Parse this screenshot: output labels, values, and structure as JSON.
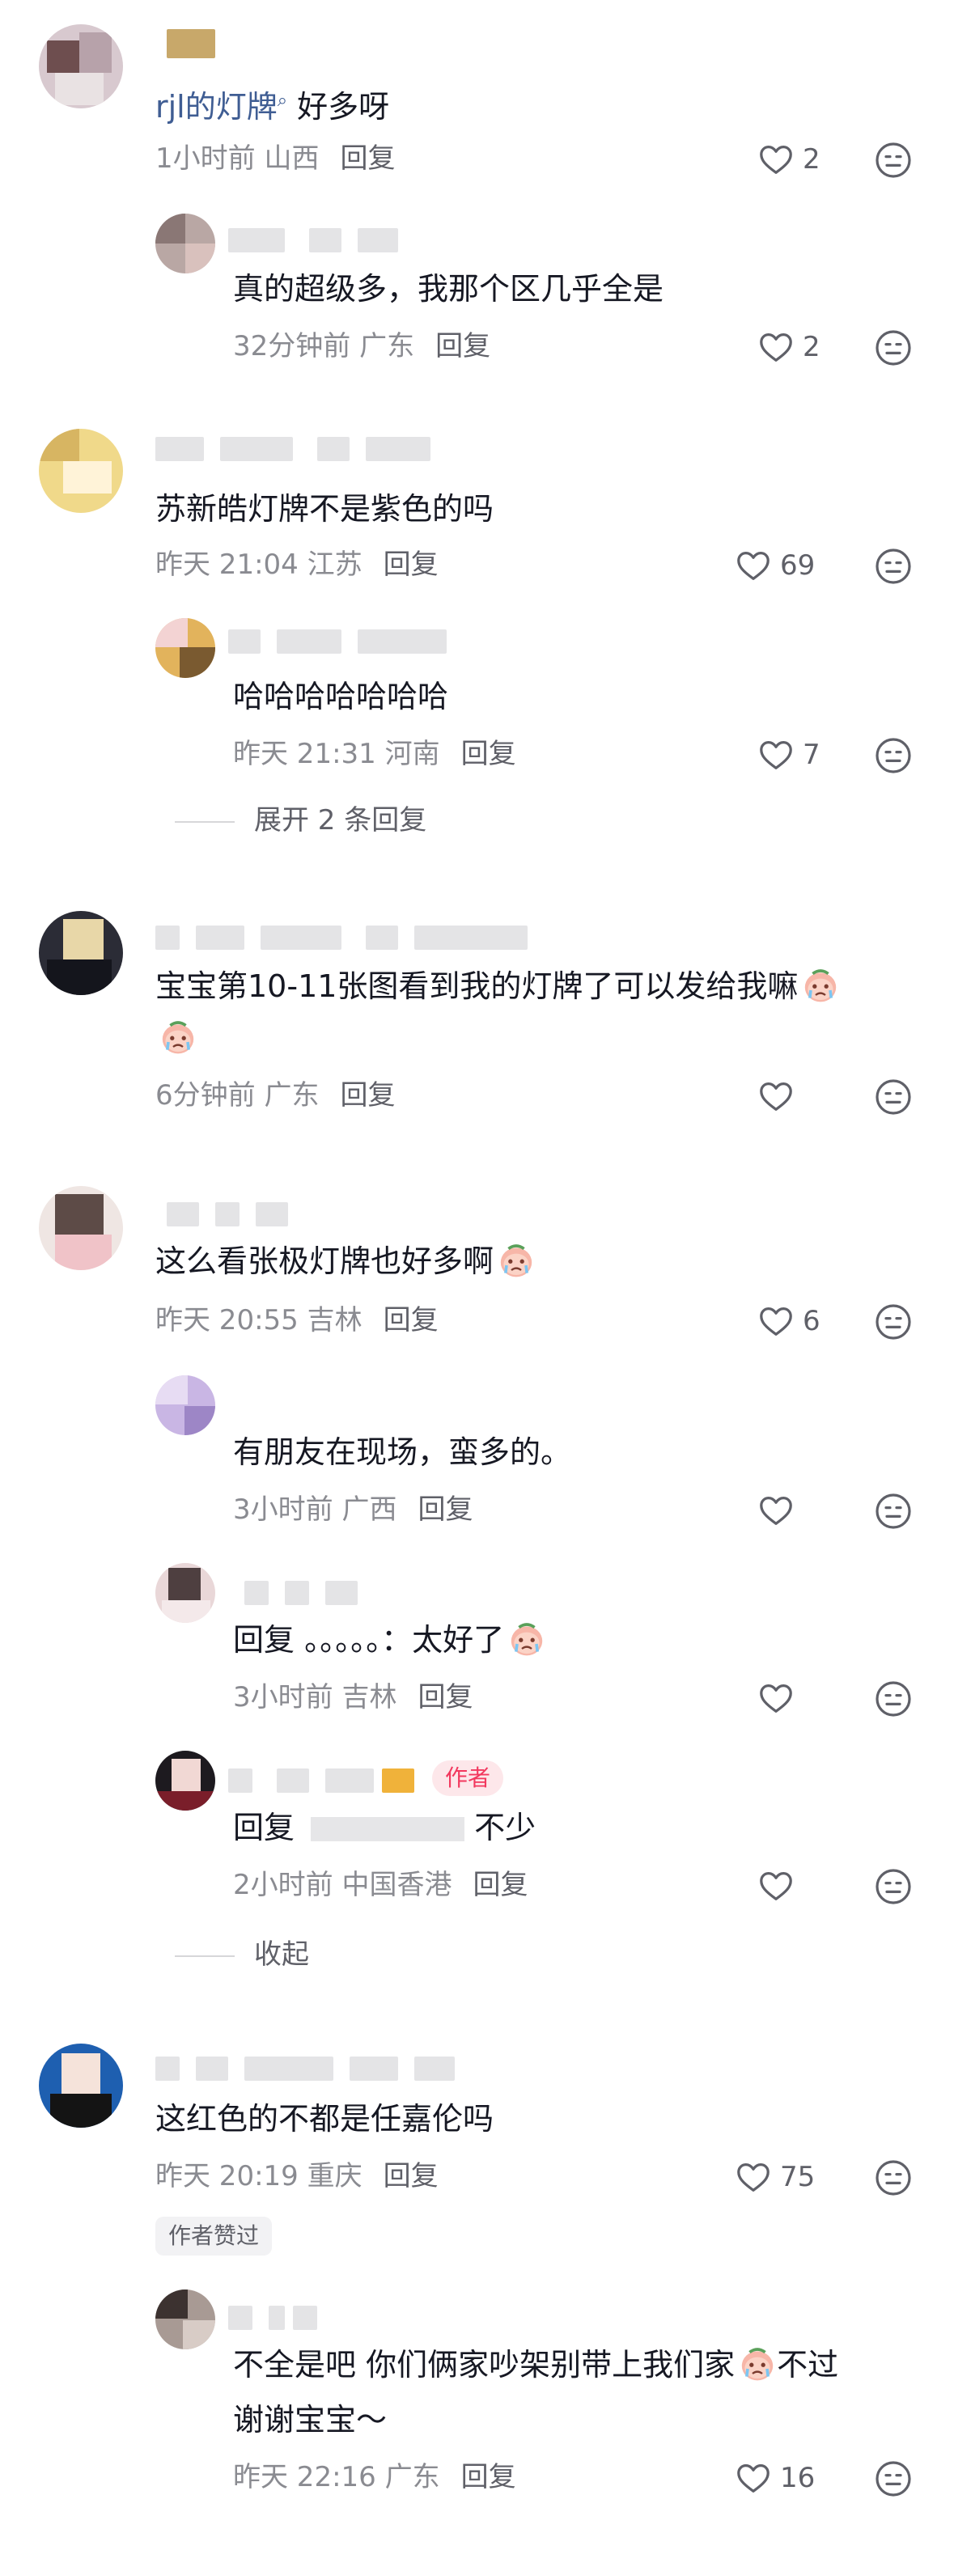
{
  "comments": [
    {
      "text_mention": "rjl的灯牌",
      "text": " 好多呀",
      "time": "1小时前",
      "region": "山西",
      "reply": "回复",
      "likes": "2",
      "replies": [
        {
          "text": "真的超级多，我那个区几乎全是",
          "time": "32分钟前",
          "region": "广东",
          "reply": "回复",
          "likes": "2"
        }
      ]
    },
    {
      "text": "苏新皓灯牌不是紫色的吗",
      "time": "昨天 21:04",
      "region": "江苏",
      "reply": "回复",
      "likes": "69",
      "replies": [
        {
          "text": "哈哈哈哈哈哈哈",
          "time": "昨天 21:31",
          "region": "河南",
          "reply": "回复",
          "likes": "7"
        }
      ],
      "expand": "展开 2 条回复"
    },
    {
      "text_line1": "宝宝第10-11张图看到我的灯牌了可以发给我嘛",
      "time": "6分钟前",
      "region": "广东",
      "reply": "回复"
    },
    {
      "text": "这么看张极灯牌也好多啊",
      "time": "昨天 20:55",
      "region": "吉林",
      "reply": "回复",
      "likes": "6",
      "replies": [
        {
          "text": "有朋友在现场，蛮多的。",
          "time": "3小时前",
          "region": "广西",
          "reply": "回复"
        },
        {
          "text_prefix": "回复 。。。。。：",
          "text": "太好了",
          "time": "3小时前",
          "region": "吉林",
          "reply": "回复"
        },
        {
          "badge": "作者",
          "text_prefix": "回复 ",
          "text_tail": "不少",
          "time": "2小时前",
          "region": "中国香港",
          "reply": "回复"
        }
      ],
      "collapse": "收起"
    },
    {
      "text": "这红色的不都是任嘉伦吗",
      "time": "昨天 20:19",
      "region": "重庆",
      "reply": "回复",
      "likes": "75",
      "tag": "作者赞过",
      "replies": [
        {
          "text_line1a": "不全是吧 你们俩家吵架别带上我们家",
          "text_line1b": "不过",
          "text_line2": "谢谢宝宝～",
          "time": "昨天 22:16",
          "region": "广东",
          "reply": "回复",
          "likes": "16"
        }
      ]
    }
  ],
  "colors": {
    "accent_author": "#f2385e",
    "mention": "#3f5d93",
    "meta": "#8a8b91"
  }
}
